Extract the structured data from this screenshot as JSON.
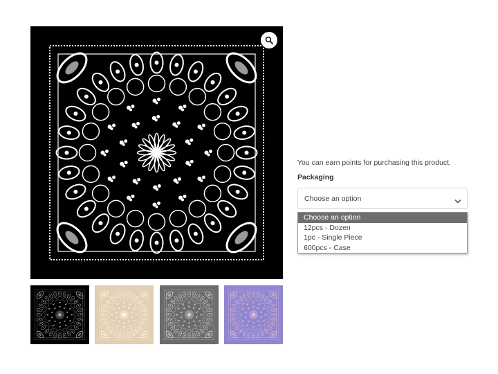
{
  "product": {
    "points_message": "You can earn points for purchasing this product.",
    "packaging_label": "Packaging",
    "select_value": "Choose an option",
    "options": [
      "Choose an option",
      "12pcs - Dozen",
      "1pc - Single Piece",
      "600pcs - Case"
    ]
  },
  "gallery": {
    "zoom_icon": "magnifier-icon",
    "thumbnails": [
      {
        "name": "black-bandana",
        "background": "#000000",
        "pattern": "#bdbdbd"
      },
      {
        "name": "tan-bandana",
        "background": "#e2cfb3",
        "pattern": "#ffffff"
      },
      {
        "name": "gray-bandana",
        "background": "#6b6b6b",
        "pattern": "#e6e6e6"
      },
      {
        "name": "purple-bandana",
        "background": "#8f86cf",
        "pattern": "#f2c9d6"
      }
    ]
  },
  "colors": {
    "selected_option_bg": "#6e6e6e",
    "text": "#3c434a"
  }
}
